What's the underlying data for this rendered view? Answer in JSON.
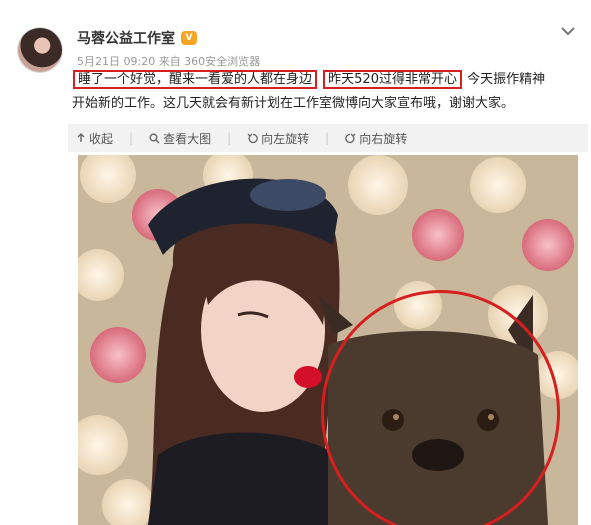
{
  "post": {
    "author": "马蓉公益工作室",
    "badge": "V",
    "meta": "5月21日 09:20 来自 360安全浏览器",
    "text_parts": [
      "睡了一个好觉，醒来一看爱的人都在身边",
      "昨天520过得非常开心",
      "今天振作精神",
      "开始新的工作。这几天就会有新计划在工作室微博向大家宣布哦，谢谢大家。"
    ]
  },
  "toolbar": {
    "items": [
      "收起",
      "查看大图",
      "向左旋转",
      "向右旋转"
    ],
    "icons": [
      "arrow-up-icon",
      "magnifier-icon",
      "rotate-left-icon",
      "rotate-right-icon"
    ]
  },
  "colors": {
    "highlight": "#d61f1f",
    "toolbar_bg": "#f2f2f2",
    "meta": "#999999"
  }
}
